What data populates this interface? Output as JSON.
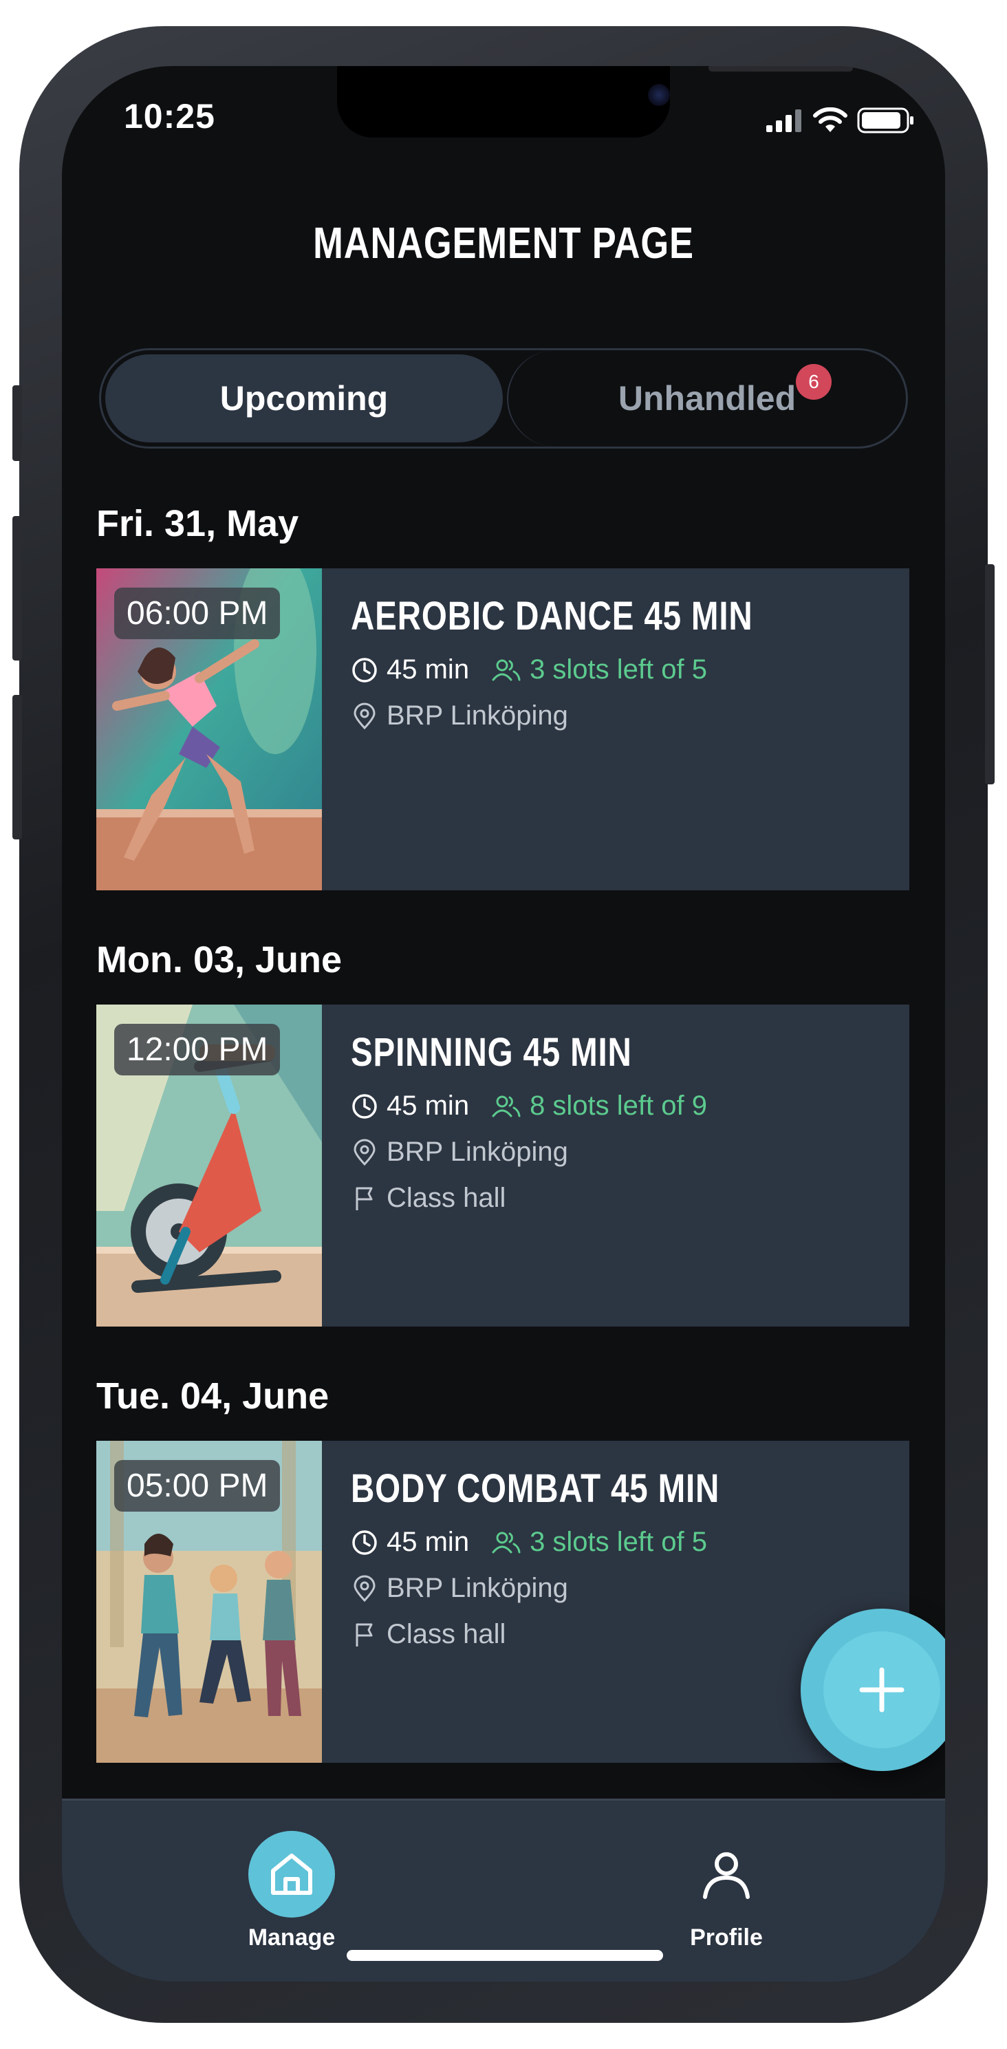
{
  "status_bar": {
    "time": "10:25"
  },
  "header": {
    "title": "MANAGEMENT PAGE"
  },
  "tabs": {
    "upcoming_label": "Upcoming",
    "unhandled_label": "Unhandled",
    "unhandled_count": "6"
  },
  "sessions": [
    {
      "date": "Fri. 31, May",
      "time": "06:00 PM",
      "title": "AEROBIC DANCE 45 MIN",
      "duration": "45 min",
      "slots": "3 slots left of 5",
      "location": "BRP Linköping",
      "room": ""
    },
    {
      "date": "Mon. 03, June",
      "time": "12:00 PM",
      "title": "SPINNING 45 MIN",
      "duration": "45 min",
      "slots": "8 slots left of 9",
      "location": "BRP Linköping",
      "room": "Class hall"
    },
    {
      "date": "Tue. 04, June",
      "time": "05:00 PM",
      "title": "BODY COMBAT 45 MIN",
      "duration": "45 min",
      "slots": "3 slots left of 5",
      "location": "BRP Linköping",
      "room": "Class hall"
    }
  ],
  "bottom_nav": {
    "manage_label": "Manage",
    "profile_label": "Profile"
  },
  "colors": {
    "background": "#0e0f11",
    "card": "#2c3542",
    "accent": "#5ec2d8",
    "slots_green": "#5ccb8e",
    "badge_red": "#d2475a"
  }
}
